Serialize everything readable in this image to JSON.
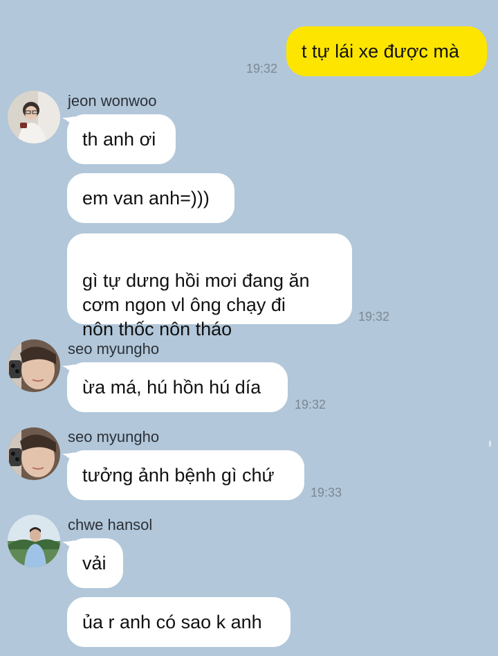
{
  "colors": {
    "background": "#b2c7d9",
    "bubble_mine": "#fee500",
    "bubble_other": "#ffffff",
    "time_text": "#7b8793"
  },
  "messages": [
    {
      "from_me": true,
      "text": "t tự lái xe được mà",
      "time": "19:32"
    },
    {
      "sender": "jeon wonwoo",
      "avatar": "person-avatar-icon",
      "text": "th anh ơi"
    },
    {
      "text": "em van anh=)))"
    },
    {
      "text": "gì tự dưng hồi mơi đang ăn\ncơm ngon vl ông chạy đi\nnôn thốc nôn tháo",
      "time": "19:32"
    },
    {
      "sender": "seo myungho",
      "avatar": "person-avatar-icon",
      "text": "ừa má, hú hồn hú día",
      "time": "19:32"
    },
    {
      "sender": "seo myungho",
      "avatar": "person-avatar-icon",
      "text": "tưởng ảnh bệnh gì chứ",
      "time": "19:33"
    },
    {
      "sender": "chwe hansol",
      "avatar": "person-avatar-icon",
      "text": "vải"
    },
    {
      "text": "ủa r anh có sao k anh"
    }
  ]
}
